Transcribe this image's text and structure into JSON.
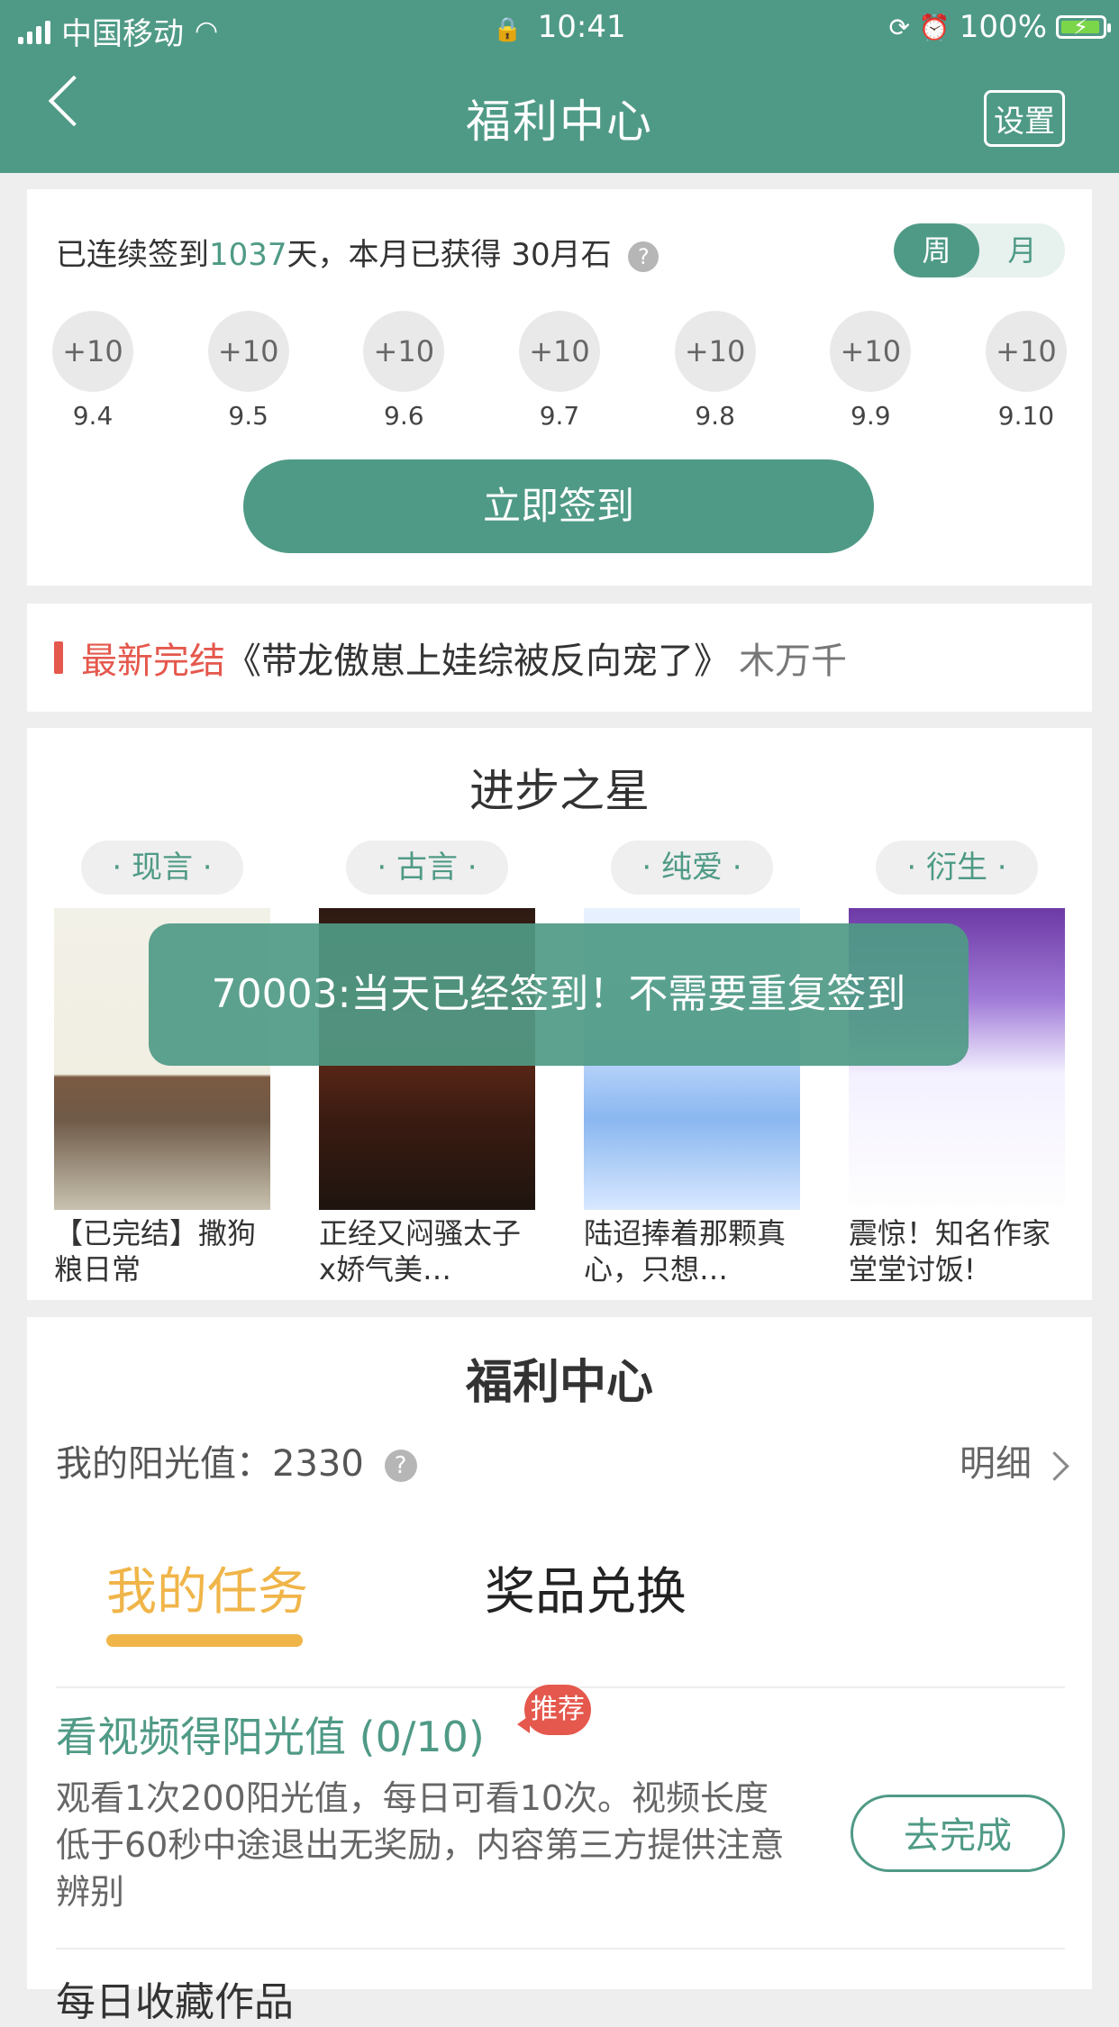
{
  "status_bar": {
    "carrier": "中国移动",
    "time": "10:41",
    "battery": "100%"
  },
  "nav": {
    "title": "福利中心",
    "settings": "设置"
  },
  "sign_in": {
    "streak_prefix": "已连续签到",
    "streak_days": "1037",
    "streak_suffix": "天，本月已获得 30月石",
    "toggle_week": "周",
    "toggle_month": "月",
    "days": [
      {
        "reward": "+10",
        "date": "9.4"
      },
      {
        "reward": "+10",
        "date": "9.5"
      },
      {
        "reward": "+10",
        "date": "9.6"
      },
      {
        "reward": "+10",
        "date": "9.7"
      },
      {
        "reward": "+10",
        "date": "9.8"
      },
      {
        "reward": "+10",
        "date": "9.9"
      },
      {
        "reward": "+10",
        "date": "9.10"
      }
    ],
    "button": "立即签到"
  },
  "news": {
    "label": "最新完结",
    "title": "《带龙傲崽上娃综被反向宠了》",
    "author": "木万千"
  },
  "progress_star": {
    "title": "进步之星",
    "categories": [
      "· 现言 ·",
      "· 古言 ·",
      "· 纯爱 ·",
      "· 衍生 ·"
    ],
    "books": [
      {
        "title": "【已完结】撒狗粮日常"
      },
      {
        "title": "正经又闷骚太子x娇气美…"
      },
      {
        "title": "陆迢捧着那颗真心，只想…"
      },
      {
        "title": "震惊！知名作家堂堂讨饭!"
      }
    ]
  },
  "toast": {
    "message": "70003:当天已经签到！不需要重复签到"
  },
  "welfare": {
    "title": "福利中心",
    "sunshine_label": "我的阳光值：",
    "sunshine_value": "2330",
    "detail": "明细",
    "tabs": {
      "tasks": "我的任务",
      "prizes": "奖品兑换"
    },
    "task": {
      "title": "看视频得阳光值 (0/10)",
      "tag": "推荐",
      "desc": "观看1次200阳光值，每日可看10次。视频长度低于60秒中途退出无奖励，内容第三方提供注意辨别",
      "button": "去完成"
    },
    "next_task_title": "每日收藏作品"
  }
}
